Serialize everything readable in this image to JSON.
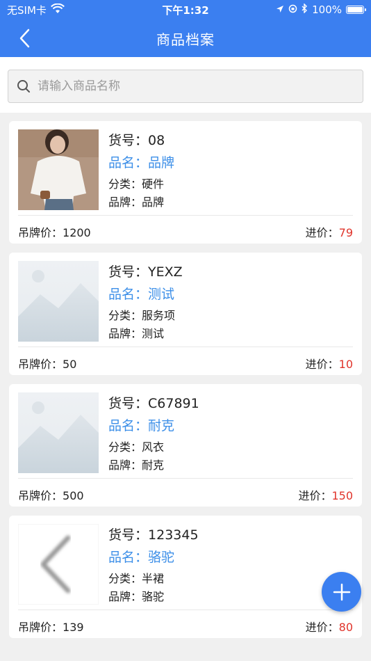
{
  "status_bar": {
    "carrier": "无SIM卡",
    "time": "下午1:32",
    "battery_text": "100%",
    "battery_level": 1.0
  },
  "nav": {
    "title": "商品档案"
  },
  "search": {
    "placeholder": "请输入商品名称",
    "value": ""
  },
  "labels": {
    "code": "货号：",
    "name": "品名：",
    "category": "分类：",
    "brand": "品牌：",
    "tag_price": "吊牌价：",
    "cost_price": "进价："
  },
  "products": [
    {
      "code": "08",
      "name": "品牌",
      "category": "硬件",
      "brand": "品牌",
      "tag_price": "1200",
      "cost_price": "79",
      "image": "photo-woman-white-top"
    },
    {
      "code": "YEXZ",
      "name": "测试",
      "category": "服务项",
      "brand": "测试",
      "tag_price": "50",
      "cost_price": "10",
      "image": "placeholder-mountains"
    },
    {
      "code": "C67891",
      "name": "耐克",
      "category": "风衣",
      "brand": "耐克",
      "tag_price": "500",
      "cost_price": "150",
      "image": "placeholder-mountains"
    },
    {
      "code": "123345",
      "name": "骆驼",
      "category": "半裙",
      "brand": "骆驼",
      "tag_price": "139",
      "cost_price": "80",
      "image": "blurred-chevron"
    }
  ],
  "colors": {
    "primary": "#3b7ff0",
    "name_blue": "#3d8fe8",
    "price_red": "#e0342b"
  }
}
